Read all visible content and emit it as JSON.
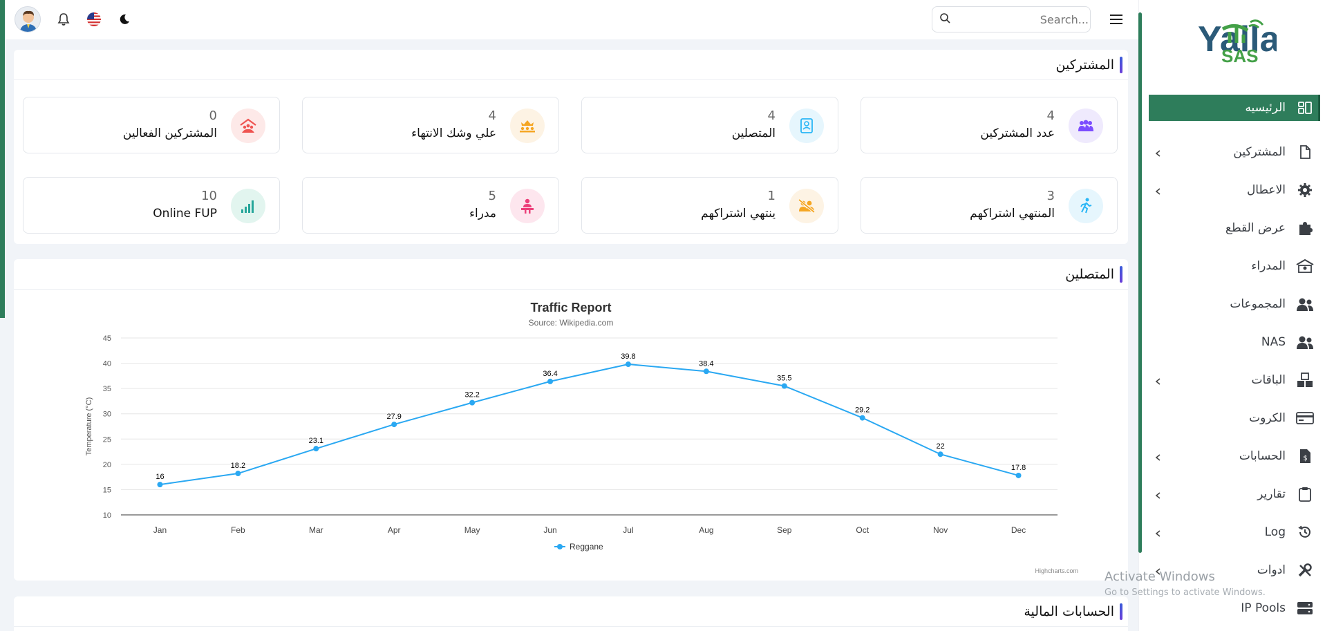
{
  "topbar": {
    "search_placeholder": "Search...",
    "icons": [
      "avatar",
      "bell-icon",
      "us-flag-icon",
      "moon-icon",
      "search-icon",
      "hamburger-icon"
    ]
  },
  "sidebar": {
    "logo_text_top": "Yalla",
    "logo_text_bottom": "SAS",
    "items": [
      {
        "label": "الرئيسيه",
        "icon": "dashboard-icon",
        "active": true,
        "chevron": false
      },
      {
        "label": "المشتركين",
        "icon": "file-icon",
        "active": false,
        "chevron": true
      },
      {
        "label": "الاعطال",
        "icon": "gear-icon",
        "active": false,
        "chevron": true
      },
      {
        "label": "عرض القطع",
        "icon": "puzzle-icon",
        "active": false,
        "chevron": false
      },
      {
        "label": "المدراء",
        "icon": "building-icon",
        "active": false,
        "chevron": false
      },
      {
        "label": "المجموعات",
        "icon": "users-icon",
        "active": false,
        "chevron": false
      },
      {
        "label": "NAS",
        "icon": "users-icon",
        "active": false,
        "chevron": false
      },
      {
        "label": "الباقات",
        "icon": "boxes-icon",
        "active": false,
        "chevron": true
      },
      {
        "label": "الكروت",
        "icon": "credit-card-icon",
        "active": false,
        "chevron": false
      },
      {
        "label": "الحسابات",
        "icon": "invoice-icon",
        "active": false,
        "chevron": true
      },
      {
        "label": "تقارير",
        "icon": "clipboard-icon",
        "active": false,
        "chevron": true
      },
      {
        "label": "Log",
        "icon": "history-icon",
        "active": false,
        "chevron": true
      },
      {
        "label": "ادوات",
        "icon": "tools-icon",
        "active": false,
        "chevron": true
      },
      {
        "label": "IP Pools",
        "icon": "server-icon",
        "active": false,
        "chevron": false
      }
    ]
  },
  "subscribers_section": {
    "title": "المشتركين",
    "stats": [
      {
        "label": "عدد المشتركين",
        "value": "4",
        "icon": "users-group-icon",
        "color": "#7c4dff",
        "bg": "#efeafd"
      },
      {
        "label": "المتصلين",
        "value": "4",
        "icon": "contact-book-icon",
        "color": "#29b6f6",
        "bg": "#e6f6fd"
      },
      {
        "label": "علي وشك الانتهاء",
        "value": "4",
        "icon": "crown-group-icon",
        "color": "#f5a623",
        "bg": "#fdf3e4"
      },
      {
        "label": "المشتركين الفعالين",
        "value": "0",
        "icon": "house-users-icon",
        "color": "#ef5350",
        "bg": "#fde9e8"
      },
      {
        "label": "المنتهي اشتراكهم",
        "value": "3",
        "icon": "walking-icon",
        "color": "#29b6f6",
        "bg": "#e6f6fd"
      },
      {
        "label": "ينتهي اشتراكهم",
        "value": "1",
        "icon": "users-slash-icon",
        "color": "#f5a623",
        "bg": "#fdf3e4"
      },
      {
        "label": "مدراء",
        "value": "5",
        "icon": "manager-desk-icon",
        "color": "#ec407a",
        "bg": "#fde6ee"
      },
      {
        "label": "Online FUP",
        "value": "10",
        "icon": "signal-bars-icon",
        "color": "#26a69a",
        "bg": "#e2f5ef"
      }
    ]
  },
  "connected_section": {
    "title": "المتصلين"
  },
  "financial_section": {
    "title": "الحسابات المالية"
  },
  "chart_data": {
    "type": "line",
    "title": "Traffic Report",
    "subtitle": "Source: Wikipedia.com",
    "ylabel": "Temperature (°C)",
    "xlabel": "",
    "categories": [
      "Jan",
      "Feb",
      "Mar",
      "Apr",
      "May",
      "Jun",
      "Jul",
      "Aug",
      "Sep",
      "Oct",
      "Nov",
      "Dec"
    ],
    "series": [
      {
        "name": "Reggane",
        "values": [
          16,
          18.2,
          23.1,
          27.9,
          32.2,
          36.4,
          39.8,
          38.4,
          35.5,
          29.2,
          22,
          17.8
        ],
        "color": "#2aa8f2"
      }
    ],
    "ylim": [
      10,
      45
    ],
    "yticks": [
      10,
      15,
      20,
      25,
      30,
      35,
      40,
      45
    ],
    "grid": true,
    "legend": "bottom-center",
    "credits": "Highcharts.com"
  },
  "watermark": {
    "line1": "Activate Windows",
    "line2": "Go to Settings to activate Windows."
  }
}
